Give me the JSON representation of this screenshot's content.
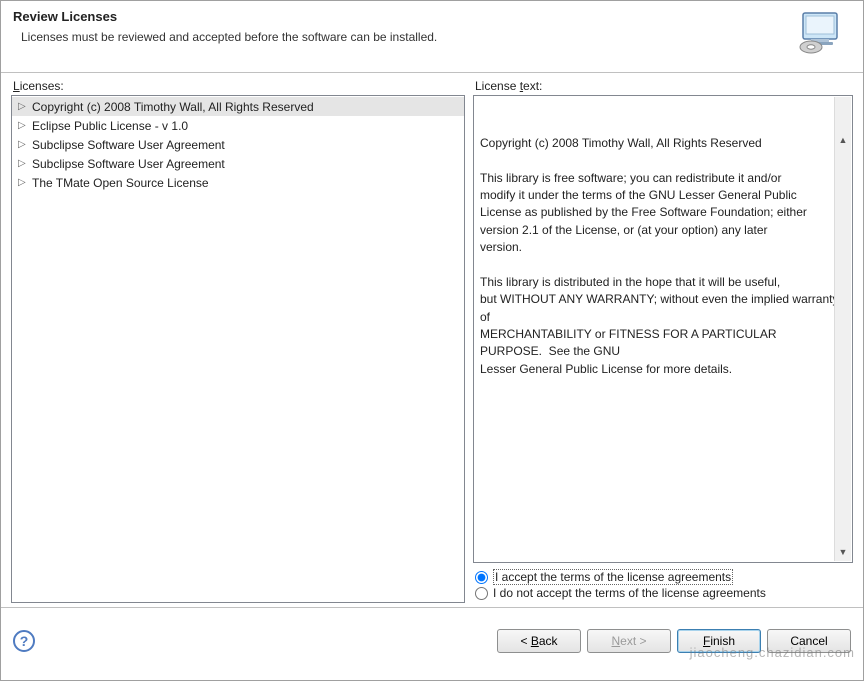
{
  "header": {
    "title": "Review Licenses",
    "subtitle": "Licenses must be reviewed and accepted before the software can be installed."
  },
  "licensesLabel": {
    "pre": "",
    "mn": "L",
    "post": "icenses:"
  },
  "licenseTextLabel": {
    "pre": "License ",
    "mn": "t",
    "post": "ext:"
  },
  "licenses": [
    {
      "label": "Copyright (c) 2008 Timothy Wall, All Rights Reserved",
      "selected": true
    },
    {
      "label": "Eclipse Public License - v 1.0",
      "selected": false
    },
    {
      "label": "Subclipse Software User Agreement",
      "selected": false
    },
    {
      "label": "Subclipse Software User Agreement",
      "selected": false
    },
    {
      "label": "The TMate Open Source License",
      "selected": false
    }
  ],
  "licenseText": "Copyright (c) 2008 Timothy Wall, All Rights Reserved\n\nThis library is free software; you can redistribute it and/or\nmodify it under the terms of the GNU Lesser General Public\nLicense as published by the Free Software Foundation; either\nversion 2.1 of the License, or (at your option) any later\nversion.\n\nThis library is distributed in the hope that it will be useful,\nbut WITHOUT ANY WARRANTY; without even the implied warranty of\nMERCHANTABILITY or FITNESS FOR A PARTICULAR PURPOSE.  See the GNU\nLesser General Public License for more details.",
  "radios": {
    "accept": {
      "pre": "I ",
      "mn": "a",
      "post": "ccept the terms of the license agreements"
    },
    "decline": {
      "pre": "I ",
      "mn": "d",
      "post": "o not accept the terms of the license agreements"
    },
    "selected": "accept"
  },
  "buttons": {
    "back": {
      "pre": "< ",
      "mn": "B",
      "post": "ack",
      "enabled": true
    },
    "next": {
      "pre": "",
      "mn": "N",
      "post": "ext >",
      "enabled": false
    },
    "finish": {
      "pre": "",
      "mn": "F",
      "post": "inish",
      "enabled": true,
      "default": true
    },
    "cancel": {
      "label": "Cancel",
      "enabled": true
    }
  },
  "watermark": "jiaocheng.chazidian.com"
}
